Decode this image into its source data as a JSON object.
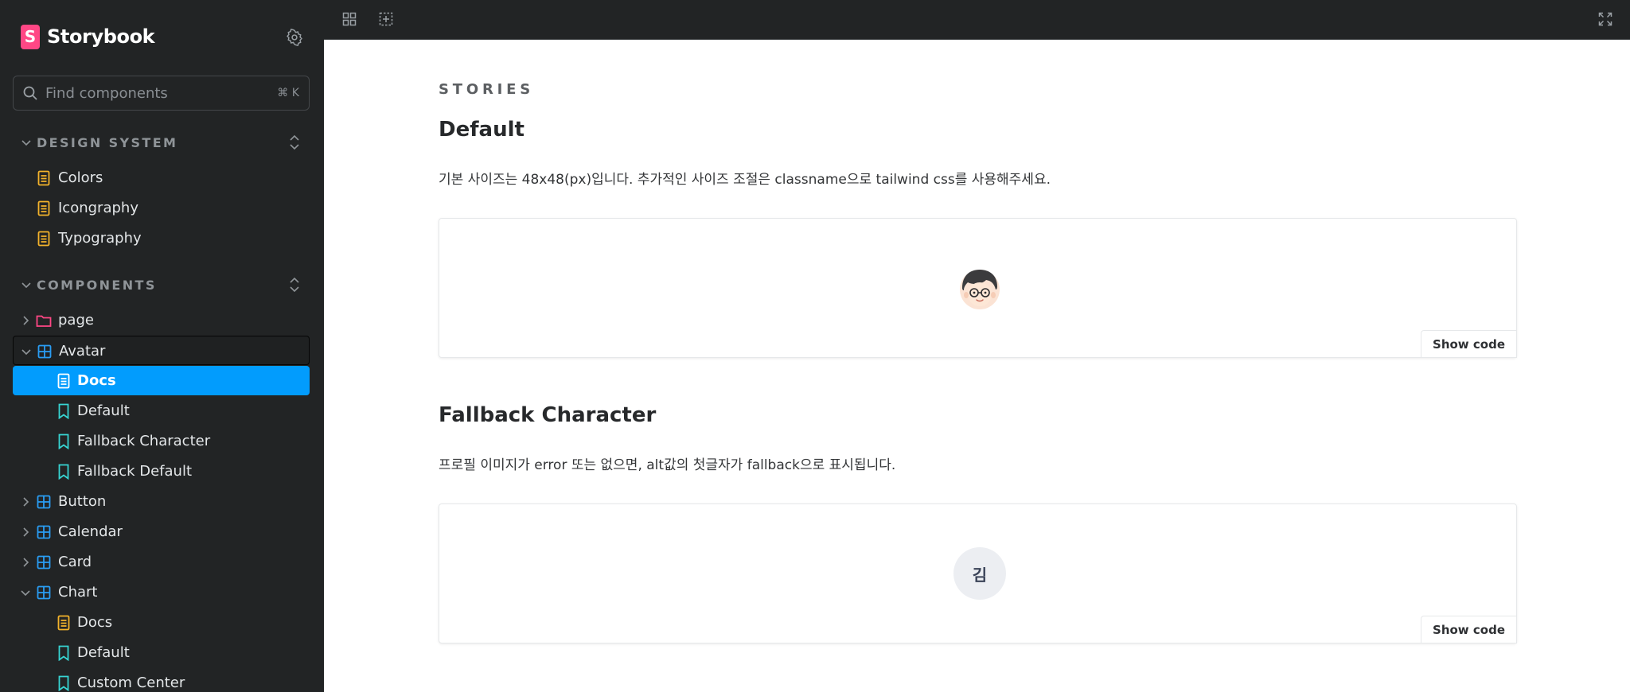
{
  "sidebar": {
    "brand": "Storybook",
    "brand_logo": "S",
    "search": {
      "placeholder": "Find components",
      "shortcut": "⌘ K"
    },
    "sections": [
      {
        "title": "DESIGN SYSTEM"
      },
      {
        "title": "COMPONENTS"
      }
    ],
    "design_items": [
      {
        "label": "Colors",
        "icon": "document-icon"
      },
      {
        "label": "Icongraphy",
        "icon": "document-icon"
      },
      {
        "label": "Typography",
        "icon": "document-icon"
      }
    ],
    "tree": [
      {
        "label": "page",
        "icon": "folder-icon"
      },
      {
        "label": "Avatar",
        "icon": "component-icon"
      },
      {
        "label": "Docs",
        "icon": "document-icon"
      },
      {
        "label": "Default",
        "icon": "bookmark-icon"
      },
      {
        "label": "Fallback Character",
        "icon": "bookmark-icon"
      },
      {
        "label": "Fallback Default",
        "icon": "bookmark-icon"
      },
      {
        "label": "Button",
        "icon": "component-icon"
      },
      {
        "label": "Calendar",
        "icon": "component-icon"
      },
      {
        "label": "Card",
        "icon": "component-icon"
      },
      {
        "label": "Chart",
        "icon": "component-icon"
      },
      {
        "label": "Docs",
        "icon": "document-icon"
      },
      {
        "label": "Default",
        "icon": "bookmark-icon"
      },
      {
        "label": "Custom Center",
        "icon": "bookmark-icon"
      }
    ]
  },
  "toolbar": {
    "buttons": [
      "grid-icon",
      "outline-icon",
      "fullscreen-icon"
    ]
  },
  "docs": {
    "stories_heading": "STORIES",
    "stories": [
      {
        "title": "Default",
        "description": "기본 사이즈는 48x48(px)입니다. 추가적인 사이즈 조절은 classname으로 tailwind css를 사용해주세요.",
        "show_code": "Show code"
      },
      {
        "title": "Fallback Character",
        "description": "프로필 이미지가 error 또는 없으면, alt값의 첫글자가 fallback으로 표시됩니다.",
        "show_code": "Show code",
        "fallback_char": "김"
      }
    ]
  },
  "colors": {
    "sidebar_bg": "#222425",
    "selected": "#029cfd",
    "brand": "#ff4785",
    "document_icon": "#f4b32b",
    "component_icon": "#2a9df4",
    "story_icon": "#37d5d3",
    "folder_icon": "#ff4785"
  }
}
